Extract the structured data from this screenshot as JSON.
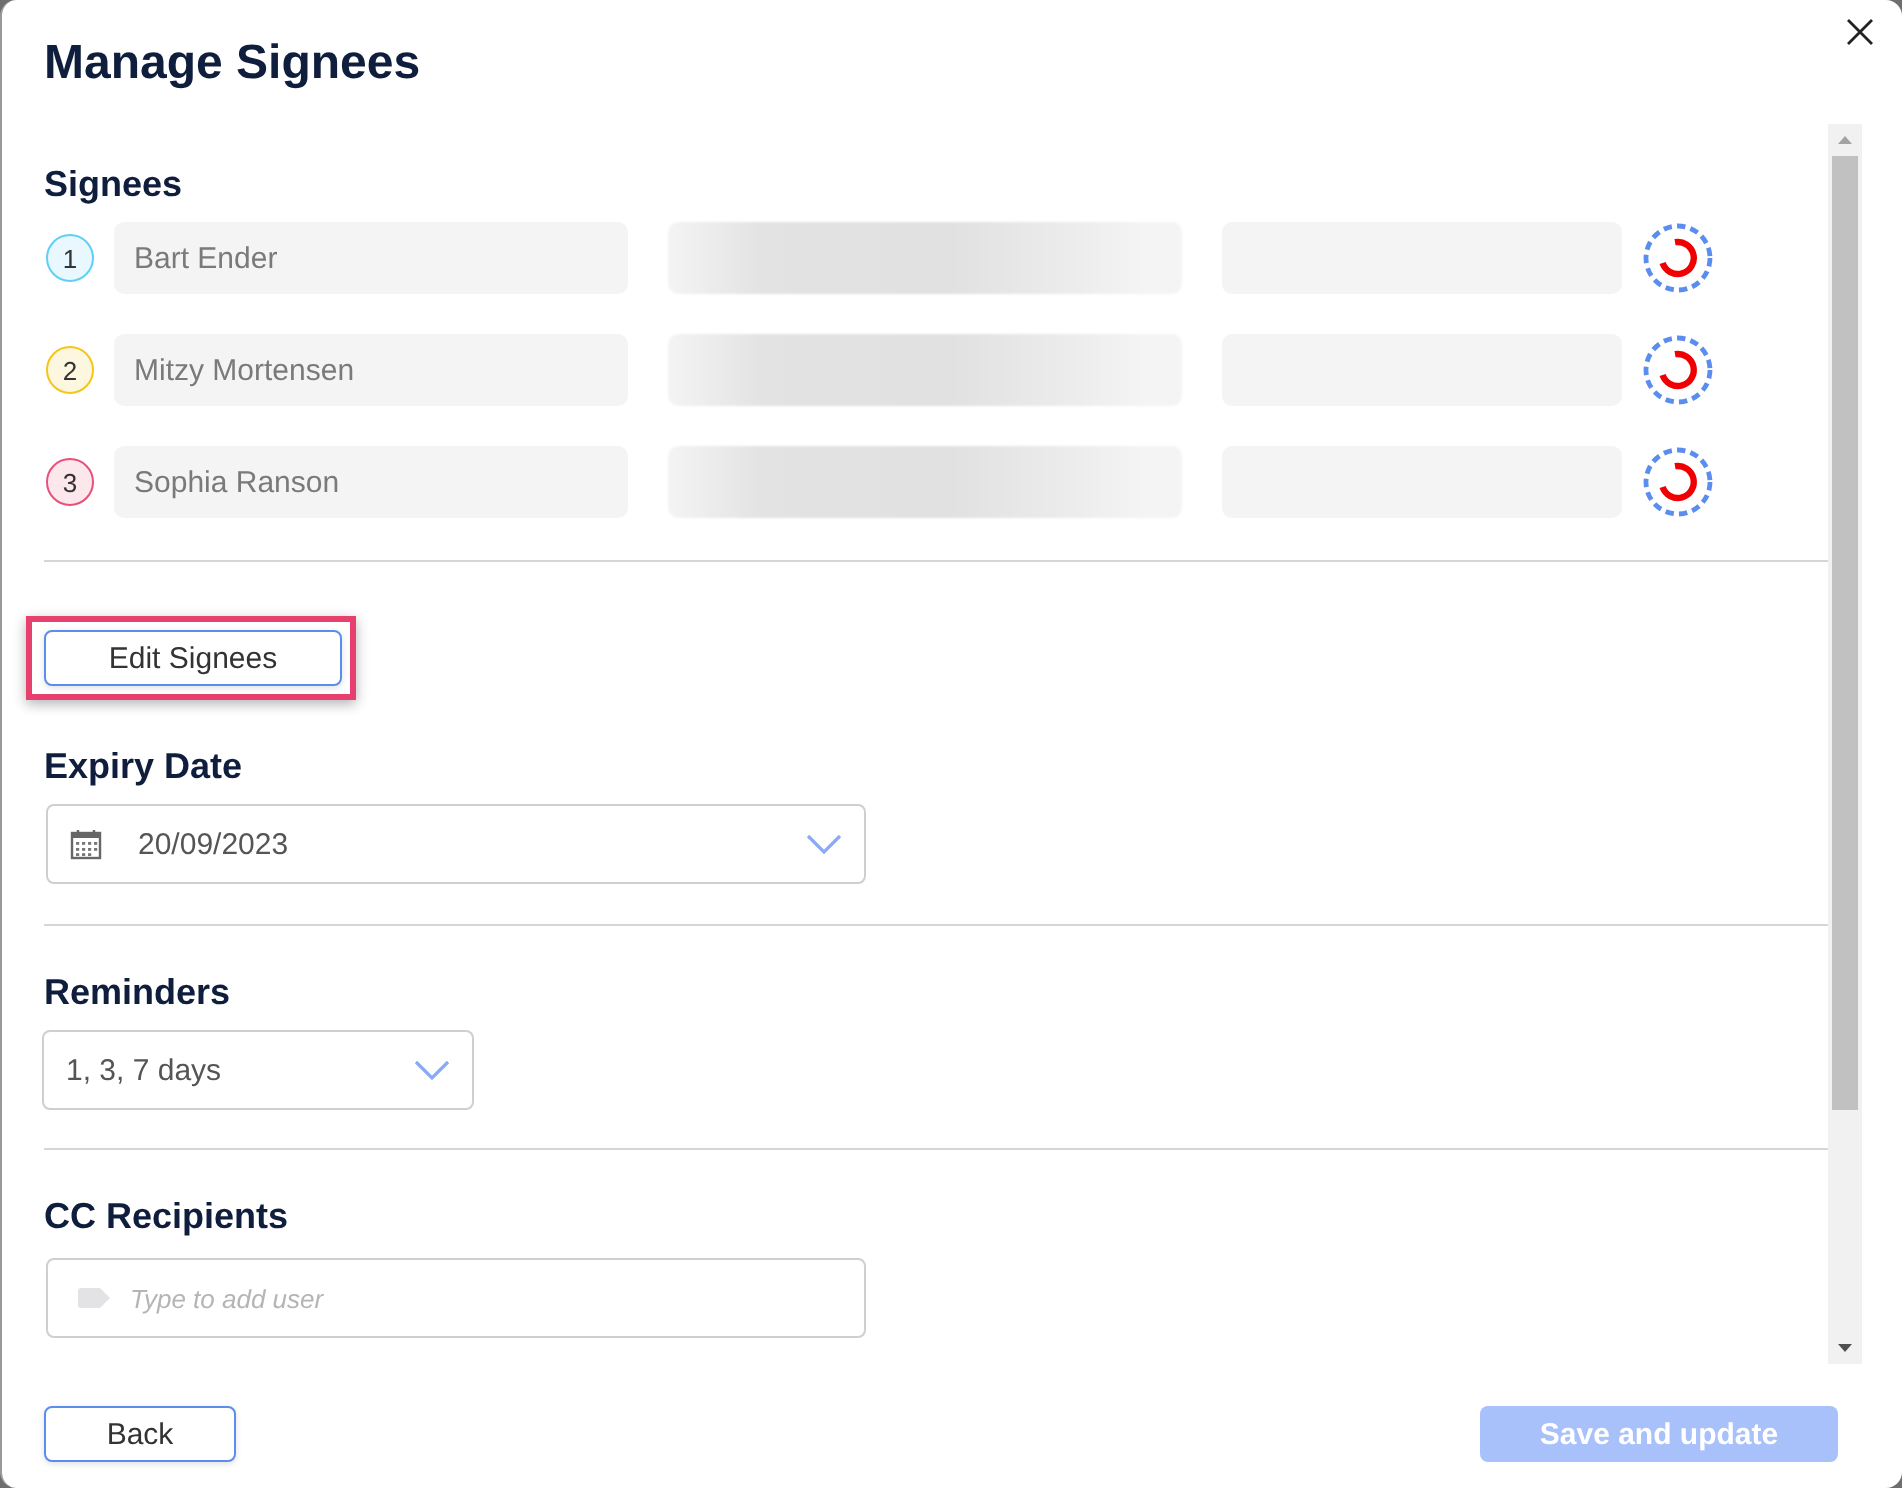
{
  "window": {
    "title": "Manage Signees"
  },
  "signees": {
    "heading": "Signees",
    "rows": [
      {
        "number": "1",
        "name": "Bart Ender",
        "color": "#5fd0f5"
      },
      {
        "number": "2",
        "name": "Mitzy Mortensen",
        "color": "#f5c518"
      },
      {
        "number": "3",
        "name": "Sophia Ranson",
        "color": "#e8507a"
      }
    ]
  },
  "edit_button": {
    "label": "Edit Signees",
    "highlighted": true
  },
  "expiry": {
    "heading": "Expiry Date",
    "value": "20/09/2023"
  },
  "reminders": {
    "heading": "Reminders",
    "value": "1, 3, 7 days"
  },
  "cc": {
    "heading": "CC Recipients",
    "placeholder": "Type to add user"
  },
  "footer": {
    "back": "Back",
    "save": {
      "label": "Save and update",
      "disabled": true
    }
  }
}
